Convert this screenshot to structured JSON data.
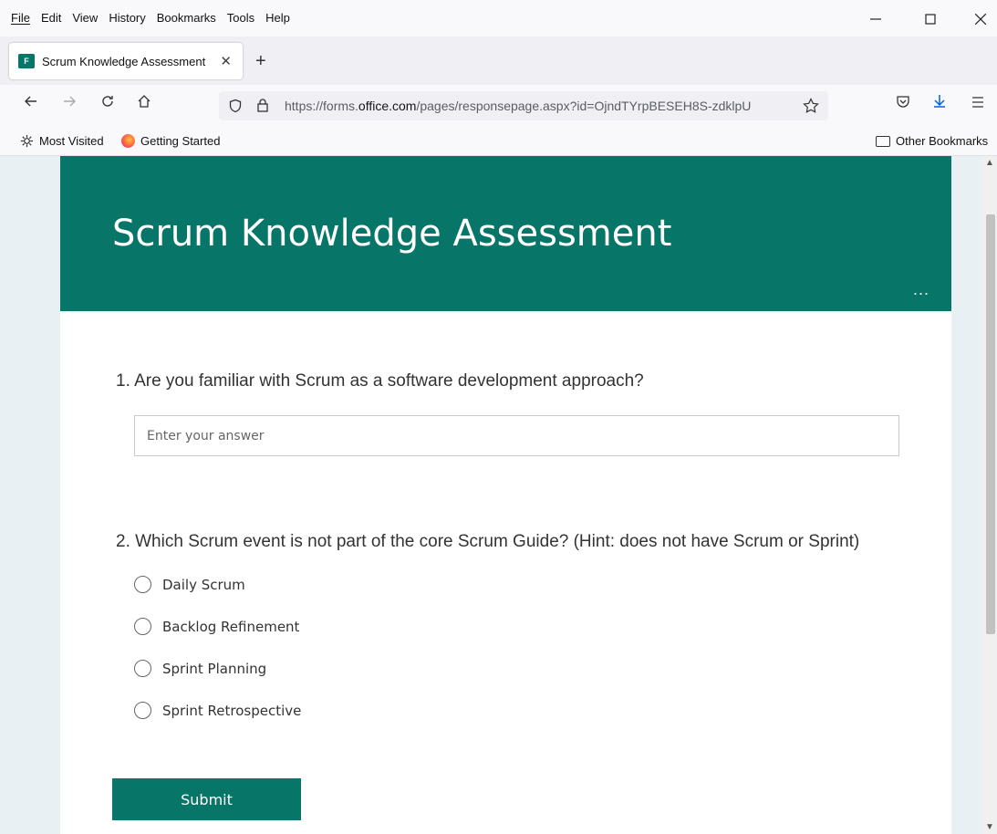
{
  "menu": {
    "items": [
      "File",
      "Edit",
      "View",
      "History",
      "Bookmarks",
      "Tools",
      "Help"
    ]
  },
  "tab": {
    "favicon_letter": "F",
    "title": "Scrum Knowledge Assessment",
    "close_glyph": "✕",
    "new_tab_glyph": "+"
  },
  "nav": {
    "url_prefix": "https://forms.",
    "url_domain": "office.com",
    "url_path": "/pages/responsepage.aspx?id=OjndTYrpBESEH8S-zdklpU"
  },
  "bookmarks": {
    "most_visited": "Most Visited",
    "getting_started": "Getting Started",
    "other": "Other Bookmarks"
  },
  "form": {
    "title": "Scrum Knowledge Assessment",
    "more_glyph": "...",
    "q1": {
      "text": "1. Are you familiar with Scrum as a software development approach?",
      "placeholder": "Enter your answer"
    },
    "q2": {
      "text": "2. Which Scrum event is not part of the core Scrum Guide? (Hint: does not have Scrum or Sprint)",
      "options": [
        "Daily Scrum",
        "Backlog Refinement",
        "Sprint Planning",
        "Sprint Retrospective"
      ]
    },
    "submit_label": "Submit"
  },
  "colors": {
    "brand": "#077568",
    "page_bg": "#e9f0f4"
  },
  "icons": {
    "back": "arrow-left-icon",
    "forward": "arrow-right-icon",
    "reload": "reload-icon",
    "home": "home-icon",
    "shield": "shield-icon",
    "lock": "lock-icon",
    "star": "star-icon",
    "pocket": "pocket-icon",
    "download": "download-icon",
    "menu": "hamburger-menu-icon"
  }
}
